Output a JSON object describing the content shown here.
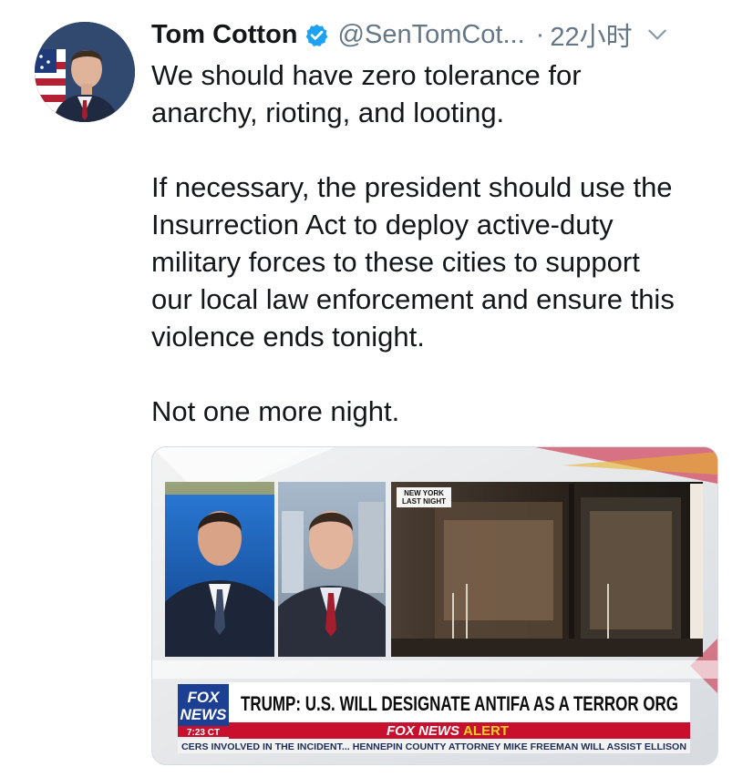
{
  "tweet": {
    "author": {
      "display_name": "Tom Cotton",
      "handle": "@SenTomCot...",
      "verified": true,
      "verified_icon": "verified-badge-icon",
      "verified_color": "#1da1f2"
    },
    "separator": "·",
    "timestamp": "22小时",
    "menu_icon": "chevron-down-icon",
    "text": {
      "line1": "We should have zero tolerance for",
      "line2": "anarchy, rioting, and looting.",
      "line3": "If necessary, the president should use the",
      "line4": "Insurrection Act to deploy active-duty",
      "line5": "military forces to these cities to support",
      "line6": "our local law enforcement and ensure this",
      "line7": "violence ends tonight.",
      "line8": "Not one more night."
    },
    "media": {
      "inset_label_line1": "NEW YORK",
      "inset_label_line2": "LAST NIGHT",
      "network_logo_line1": "FOX",
      "network_logo_line2": "NEWS",
      "clock": "7:23 CT",
      "headline": "TRUMP: U.S. WILL DESIGNATE ANTIFA AS A TERROR ORG",
      "alert_prefix": "FOX NEWS",
      "alert_word": "ALERT",
      "ticker": "CERS INVOLVED IN THE INCIDENT... HENNEPIN COUNTY ATTORNEY MIKE FREEMAN WILL ASSIST ELLISON"
    }
  },
  "colors": {
    "name_text": "#14171a",
    "secondary_text": "#657786",
    "fox_red": "#c8102e",
    "fox_blue": "#1c3f94"
  }
}
